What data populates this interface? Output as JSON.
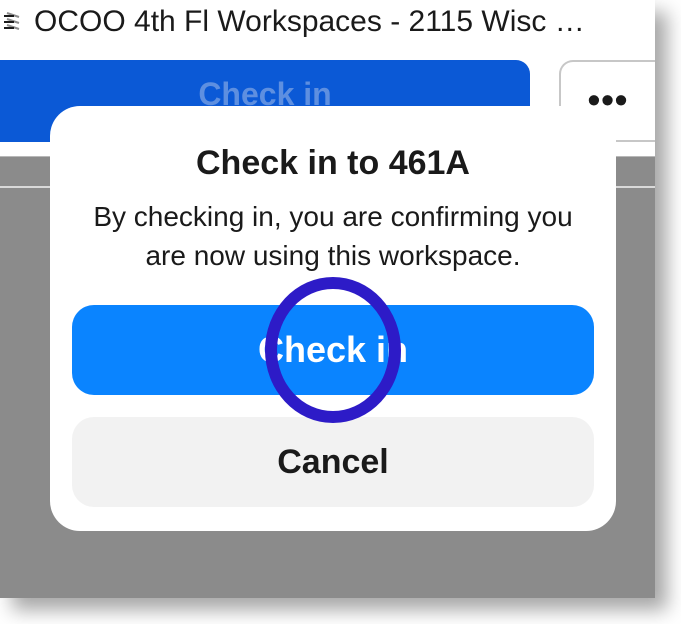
{
  "header": {
    "title": "OCOO 4th Fl Workspaces - 2115 Wisc …",
    "icon_name": "location-icon"
  },
  "toolbar": {
    "checkin_label": "Check in",
    "more_label": "•••"
  },
  "modal": {
    "title": "Check in to 461A",
    "body": "By checking in, you are confirming you are now using this workspace.",
    "primary_label": "Check in",
    "secondary_label": "Cancel"
  },
  "annotation": {
    "highlight_color": "#2d1bc7"
  }
}
